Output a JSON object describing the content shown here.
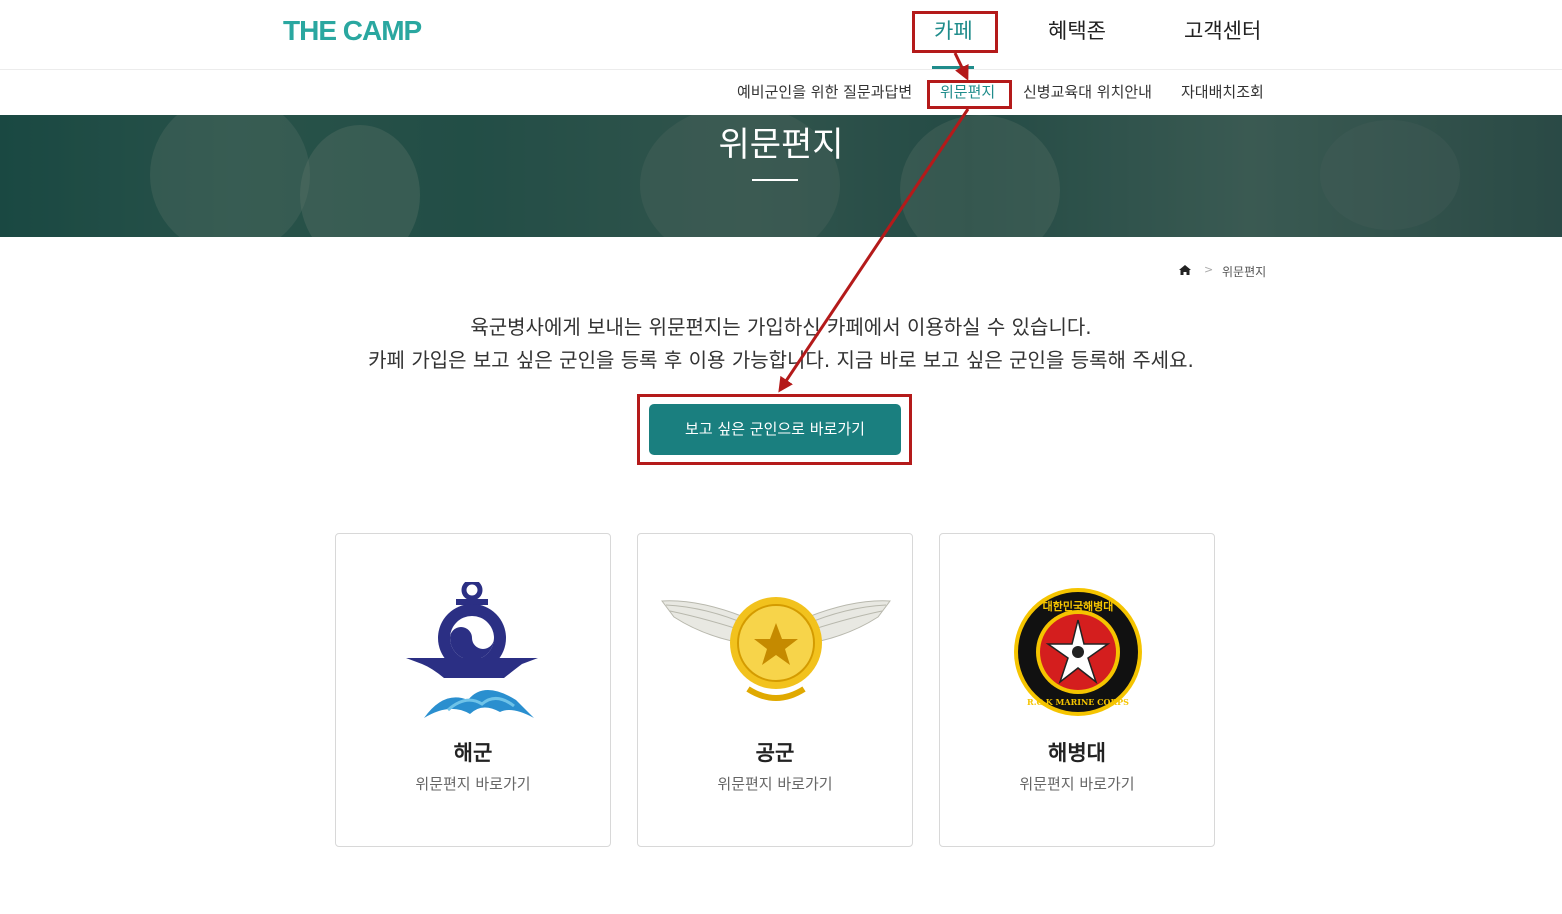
{
  "header": {
    "logo": "THE CAMP",
    "nav": [
      "카페",
      "혜택존",
      "고객센터"
    ],
    "active_nav": "카페"
  },
  "subnav": [
    "예비군인을 위한 질문과답변",
    "위문편지",
    "신병교육대 위치안내",
    "자대배치조회"
  ],
  "banner": {
    "title": "위문편지"
  },
  "breadcrumb": {
    "current": "위문편지"
  },
  "intro": {
    "line1": "육군병사에게 보내는 위문편지는 가입하신 카페에서 이용하실 수 있습니다.",
    "line2": "카페 가입은 보고 싶은 군인을 등록 후 이용 가능합니다. 지금 바로 보고 싶은 군인을 등록해 주세요."
  },
  "cta": {
    "label": "보고 싶은 군인으로 바로가기"
  },
  "cards": [
    {
      "name": "해군",
      "link": "위문편지 바로가기",
      "icon": "navy-emblem"
    },
    {
      "name": "공군",
      "link": "위문편지 바로가기",
      "icon": "air-force-emblem"
    },
    {
      "name": "해병대",
      "link": "위문편지 바로가기",
      "icon": "marine-corps-emblem",
      "emblem_text": "대한민국해병대",
      "emblem_text_en": "R.O.K MARINE CORPS"
    }
  ],
  "colors": {
    "accent": "#1f8c8b",
    "button": "#1a7f7f",
    "annotation": "#b41a1a",
    "logo": "#2aa7a0"
  }
}
